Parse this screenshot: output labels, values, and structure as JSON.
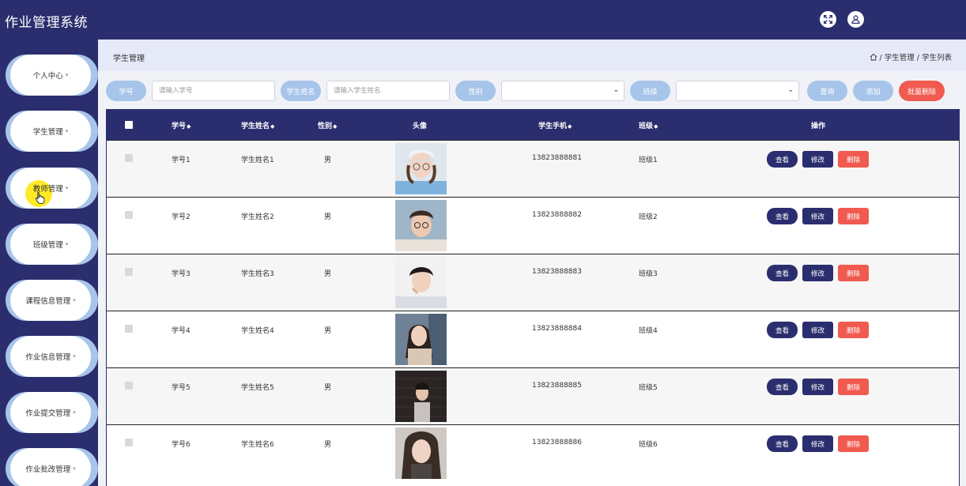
{
  "app": {
    "title": "作业管理系统"
  },
  "topbar": {
    "fullscreen_icon": "expand-arrows-icon",
    "user_icon": "user-icon"
  },
  "sidebar": {
    "items": [
      {
        "label": "个人中心"
      },
      {
        "label": "学生管理"
      },
      {
        "label": "教师管理"
      },
      {
        "label": "班级管理"
      },
      {
        "label": "课程信息管理"
      },
      {
        "label": "作业信息管理"
      },
      {
        "label": "作业提交管理"
      },
      {
        "label": "作业批改管理"
      }
    ],
    "caret": "▾"
  },
  "header": {
    "title": "学生管理",
    "breadcrumb": {
      "home_icon": "home-icon",
      "path": "/ 学生管理 / 学生列表"
    }
  },
  "search": {
    "xuehao_label": "学号",
    "xuehao_placeholder": "请输入学号",
    "name_label": "学生姓名",
    "name_placeholder": "请输入学生姓名",
    "gender_label": "性别",
    "class_label": "班级",
    "query_btn": "查询",
    "add_btn": "添加",
    "batch_delete_btn": "批量删除"
  },
  "table": {
    "columns": {
      "xuehao": "学号",
      "name": "学生姓名",
      "gender": "性别",
      "avatar": "头像",
      "phone": "学生手机",
      "class": "班级",
      "ops": "操作"
    },
    "sort_glyph": "◆",
    "rows": [
      {
        "xuehao": "学号1",
        "name": "学生姓名1",
        "gender": "男",
        "phone": "13823888881",
        "class": "班级1"
      },
      {
        "xuehao": "学号2",
        "name": "学生姓名2",
        "gender": "男",
        "phone": "13823888882",
        "class": "班级2"
      },
      {
        "xuehao": "学号3",
        "name": "学生姓名3",
        "gender": "男",
        "phone": "13823888883",
        "class": "班级3"
      },
      {
        "xuehao": "学号4",
        "name": "学生姓名4",
        "gender": "男",
        "phone": "13823888884",
        "class": "班级4"
      },
      {
        "xuehao": "学号5",
        "name": "学生姓名5",
        "gender": "男",
        "phone": "13823888885",
        "class": "班级5"
      },
      {
        "xuehao": "学号6",
        "name": "学生姓名6",
        "gender": "男",
        "phone": "13823888886",
        "class": "班级6"
      }
    ],
    "actions": {
      "view": "查看",
      "edit": "修改",
      "delete": "删除"
    }
  },
  "colors": {
    "primary": "#2b2e6e",
    "accent_light": "#a7c5ea",
    "danger": "#f05a4f"
  }
}
